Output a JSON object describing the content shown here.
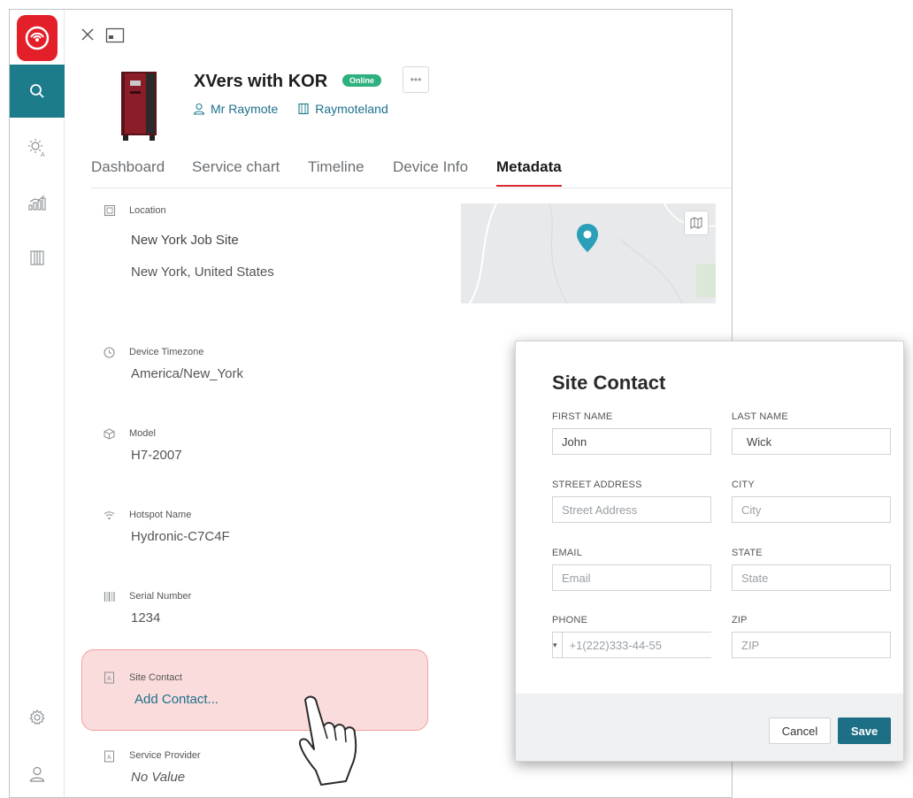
{
  "device": {
    "title": "XVers with KOR",
    "status": "Online",
    "more": "•••",
    "owner": "Mr Raymote",
    "site": "Raymoteland"
  },
  "tabs": [
    "Dashboard",
    "Service chart",
    "Timeline",
    "Device Info",
    "Metadata"
  ],
  "active_tab": "Metadata",
  "metadata": {
    "location": {
      "label": "Location",
      "name": "New York Job Site",
      "address": "New York, United States"
    },
    "timezone": {
      "label": "Device Timezone",
      "value": "America/New_York"
    },
    "model": {
      "label": "Model",
      "value": "H7-2007"
    },
    "hotspot": {
      "label": "Hotspot Name",
      "value": "Hydronic-C7C4F"
    },
    "serial": {
      "label": "Serial Number",
      "value": "1234"
    },
    "site_contact": {
      "label": "Site Contact",
      "action": "Add Contact..."
    },
    "service_provider": {
      "label": "Service Provider",
      "value": "No Value"
    }
  },
  "dialog": {
    "title": "Site Contact",
    "first_name": {
      "label": "FIRST NAME",
      "value": "John"
    },
    "last_name": {
      "label": "LAST NAME",
      "value": "Wick"
    },
    "street": {
      "label": "STREET ADDRESS",
      "placeholder": "Street Address"
    },
    "city": {
      "label": "CITY",
      "placeholder": "City"
    },
    "email": {
      "label": "EMAIL",
      "placeholder": "Email"
    },
    "state": {
      "label": "STATE",
      "placeholder": "State"
    },
    "phone": {
      "label": "PHONE",
      "placeholder": "+1(222)333-44-55",
      "country_caret": "▾"
    },
    "zip": {
      "label": "ZIP",
      "placeholder": "ZIP"
    },
    "cancel": "Cancel",
    "save": "Save"
  },
  "colors": {
    "brand_red": "#e3202a",
    "accent_teal": "#1c7c8c",
    "online_green": "#2fb07e",
    "highlight_pink": "#fbdcdc"
  },
  "icons": {
    "sidebar": [
      "search-icon",
      "sun-icon",
      "analytics-icon",
      "building-icon",
      "settings-icon",
      "user-icon"
    ],
    "topbar": [
      "close-icon",
      "minimize-window-icon"
    ]
  }
}
